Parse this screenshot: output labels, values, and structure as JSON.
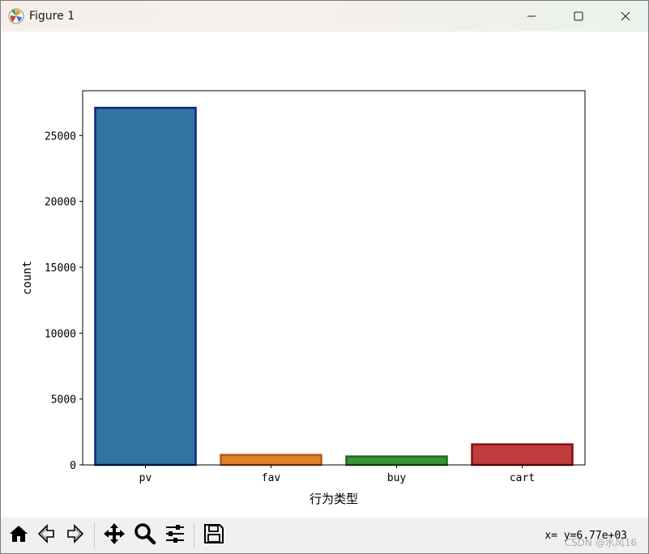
{
  "window": {
    "title": "Figure 1",
    "controls": {
      "minimize": "minimize-icon",
      "maximize": "maximize-icon",
      "close": "close-icon"
    }
  },
  "chart_data": {
    "type": "bar",
    "categories": [
      "pv",
      "fav",
      "buy",
      "cart"
    ],
    "values": [
      27100,
      760,
      640,
      1560
    ],
    "colors": [
      "#3274a1",
      "#e1812c",
      "#3a923a",
      "#c03d3e"
    ],
    "edge_colors": [
      "#0d2680",
      "#b85a14",
      "#1c6b1c",
      "#8b0f0f"
    ],
    "xlabel": "行为类型",
    "ylabel": "count",
    "ylim": [
      0,
      28400
    ],
    "yticks": [
      0,
      5000,
      10000,
      15000,
      20000,
      25000
    ],
    "grid": false,
    "legend": "none"
  },
  "toolbar": {
    "buttons": [
      "home-icon",
      "back-icon",
      "forward-icon",
      "pan-icon",
      "zoom-icon",
      "configure-subplots-icon",
      "save-icon"
    ],
    "coords": "x= y=6.77e+03",
    "watermark": "CSDN @水风16"
  }
}
